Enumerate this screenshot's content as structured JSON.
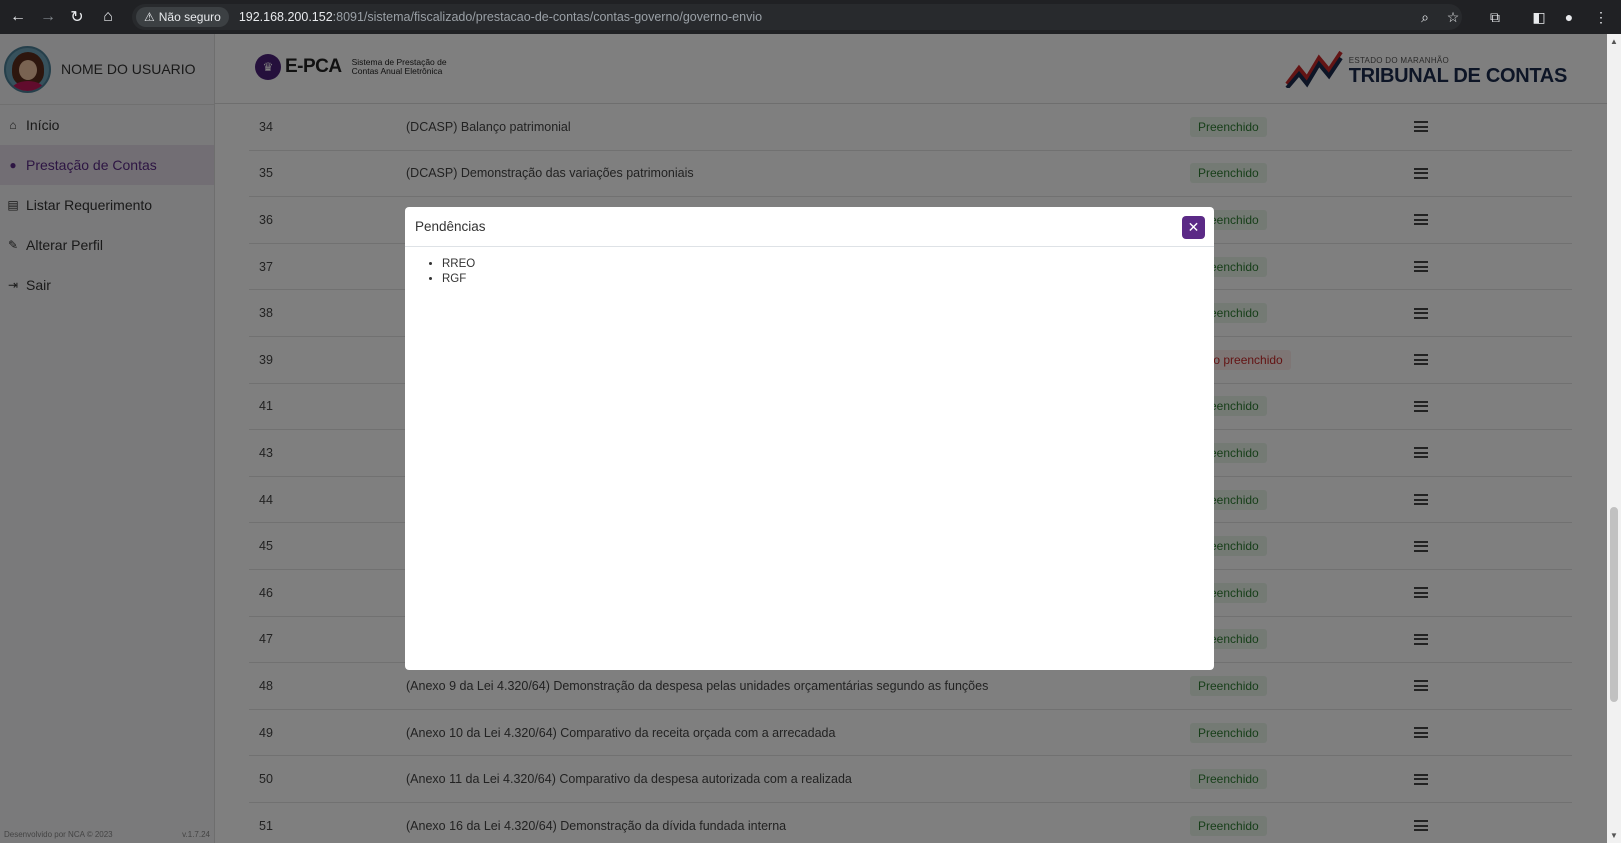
{
  "browser": {
    "security_label": "Não seguro",
    "url_host": "192.168.200.152",
    "url_rest": ":8091/sistema/fiscalizado/prestacao-de-contas/contas-governo/governo-envio"
  },
  "sidebar": {
    "user_name": "NOME DO USUARIO",
    "items": [
      {
        "label": "Início",
        "icon": "home-icon"
      },
      {
        "label": "Prestação de Contas",
        "icon": "user-icon"
      },
      {
        "label": "Listar Requerimento",
        "icon": "document-icon"
      },
      {
        "label": "Alterar Perfil",
        "icon": "user-edit-icon"
      },
      {
        "label": "Sair",
        "icon": "logout-icon"
      }
    ],
    "footer_left": "Desenvolvido por NCA © 2023",
    "footer_right": "v.1.7.24"
  },
  "header": {
    "app_name": "E-PCA",
    "app_subtitle": "Sistema de Prestação de Contas Anual Eletrônica",
    "org_small": "ESTADO DO MARANHÃO",
    "org_big": "TRIBUNAL DE CONTAS"
  },
  "table": {
    "rows": [
      {
        "num": "34",
        "desc": "(DCASP) Balanço patrimonial",
        "status": "Preenchido"
      },
      {
        "num": "35",
        "desc": "(DCASP) Demonstração das variações patrimoniais",
        "status": "Preenchido"
      },
      {
        "num": "36",
        "desc": "",
        "status": "Preenchido"
      },
      {
        "num": "37",
        "desc": "",
        "status": "Preenchido"
      },
      {
        "num": "38",
        "desc": "",
        "status": "Preenchido"
      },
      {
        "num": "39",
        "desc": "",
        "status": "Não preenchido"
      },
      {
        "num": "41",
        "desc": "",
        "status": "Preenchido"
      },
      {
        "num": "43",
        "desc": "",
        "status": "Preenchido"
      },
      {
        "num": "44",
        "desc": "",
        "status": "Preenchido"
      },
      {
        "num": "45",
        "desc": "",
        "status": "Preenchido"
      },
      {
        "num": "46",
        "desc": "",
        "status": "Preenchido"
      },
      {
        "num": "47",
        "desc": "",
        "status": "Preenchido"
      },
      {
        "num": "48",
        "desc": "(Anexo 9 da Lei 4.320/64) Demonstração da despesa pelas unidades orçamentárias segundo as funções",
        "status": "Preenchido"
      },
      {
        "num": "49",
        "desc": "(Anexo 10 da Lei 4.320/64) Comparativo da receita orçada com a arrecadada",
        "status": "Preenchido"
      },
      {
        "num": "50",
        "desc": "(Anexo 11 da Lei 4.320/64) Comparativo da despesa autorizada com a realizada",
        "status": "Preenchido"
      },
      {
        "num": "51",
        "desc": "(Anexo 16 da Lei 4.320/64) Demonstração da dívida fundada interna",
        "status": "Preenchido"
      }
    ]
  },
  "modal": {
    "title": "Pendências",
    "items": [
      "RREO",
      "RGF"
    ]
  }
}
